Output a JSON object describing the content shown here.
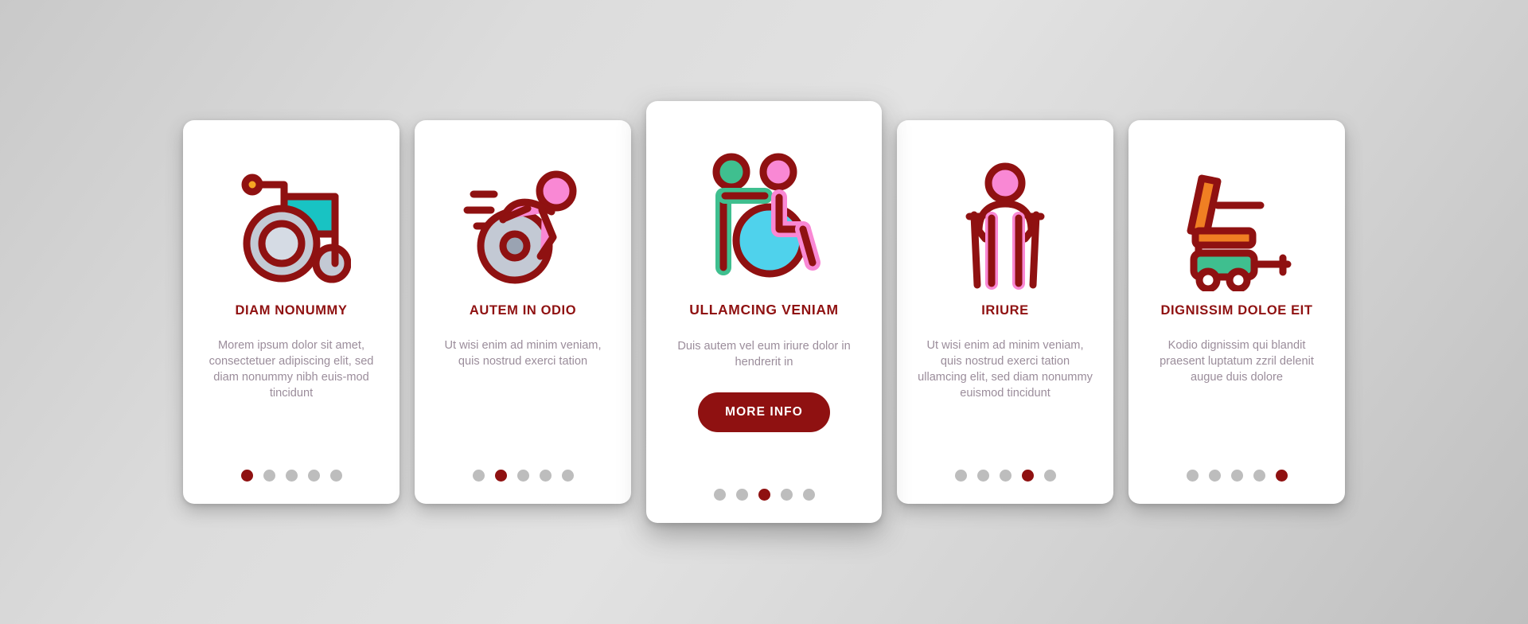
{
  "background": {
    "color_light": "#e2e2e2",
    "color_dark": "#bfbfbf"
  },
  "theme": {
    "accent": "#8f1111",
    "title_color": "#8f1111",
    "body_color": "#9b8d9b",
    "dot_inactive": "#bdbdbd",
    "card_background": "#ffffff",
    "icon_stroke": "#8f1111",
    "icon_teal": "#18c3c3",
    "icon_grey": "#c3c9d4",
    "icon_pink": "#f988d4",
    "icon_green": "#3fbf8f",
    "icon_cyan": "#4fd2ec",
    "icon_orange": "#f07f23"
  },
  "cards": [
    {
      "id": "card-1",
      "icon": "wheelchair-icon",
      "title": "DIAM NONUMMY",
      "body": "Morem ipsum dolor sit amet, consectetuer adipiscing elit, sed diam nonummy nibh euis-mod tincidunt",
      "featured": false,
      "dots": {
        "count": 5,
        "active": 0
      }
    },
    {
      "id": "card-2",
      "icon": "wheelchair-racer-icon",
      "title": "AUTEM IN ODIO",
      "body": "Ut wisi enim ad minim veniam, quis nostrud exerci tation",
      "featured": false,
      "dots": {
        "count": 5,
        "active": 1
      }
    },
    {
      "id": "card-3",
      "icon": "caregiver-wheelchair-icon",
      "title": "ULLAMCING VENIAM",
      "body": "Duis autem vel eum iriure dolor in hendrerit in",
      "button_label": "MORE INFO",
      "featured": true,
      "dots": {
        "count": 5,
        "active": 2
      }
    },
    {
      "id": "card-4",
      "icon": "person-crutches-icon",
      "title": "IRIURE",
      "body": "Ut wisi enim ad minim veniam, quis nostrud exerci tation ullamcing elit, sed diam nonummy euismod tincidunt",
      "featured": false,
      "dots": {
        "count": 5,
        "active": 3
      }
    },
    {
      "id": "card-5",
      "icon": "electric-wheelchair-icon",
      "title": "DIGNISSIM DOLOE EIT",
      "body": "Kodio dignissim qui blandit praesent luptatum zzril delenit augue duis dolore",
      "featured": false,
      "dots": {
        "count": 5,
        "active": 4
      }
    }
  ]
}
